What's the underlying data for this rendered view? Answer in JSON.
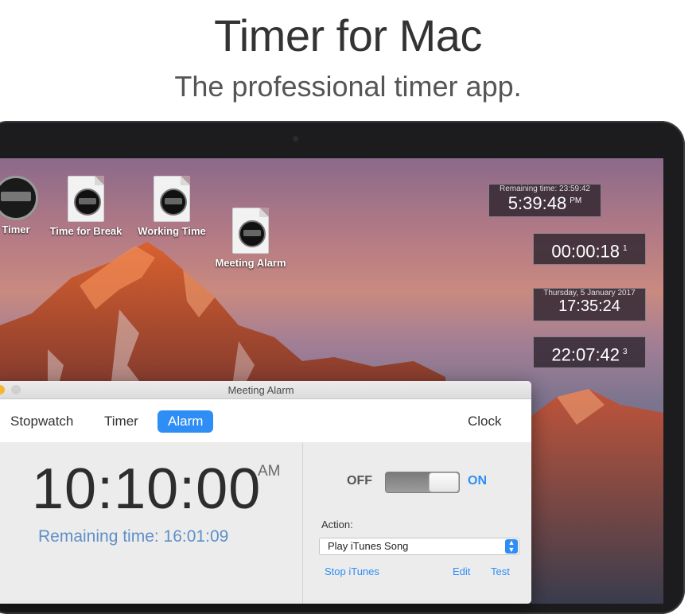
{
  "header": {
    "title": "Timer for Mac",
    "subtitle": "The professional timer app."
  },
  "desktop_icons": [
    {
      "label": "Timer",
      "icon": "clock-icon"
    },
    {
      "label": "Time for Break",
      "icon": "document-clock-icon"
    },
    {
      "label": "Working Time",
      "icon": "document-clock-icon"
    },
    {
      "label": "Meeting Alarm",
      "icon": "document-clock-icon"
    }
  ],
  "floating_timers": [
    {
      "caption": "Remaining time: 23:59:42",
      "time": "5:39:48",
      "suffix": "PM"
    },
    {
      "time": "00:00:18",
      "suffix": "1"
    },
    {
      "caption": "Thursday, 5 January 2017",
      "time": "17:35:24"
    },
    {
      "time": "22:07:42",
      "suffix": "3"
    }
  ],
  "window": {
    "title": "Meeting Alarm",
    "tabs": [
      "Stopwatch",
      "Timer",
      "Alarm",
      "Clock"
    ],
    "active_tab": "Alarm",
    "alarm_time": "10:10:00",
    "ampm": "AM",
    "remaining": "Remaining time: 16:01:09",
    "toggle": {
      "off_label": "OFF",
      "on_label": "ON",
      "state": "on"
    },
    "action_label": "Action:",
    "action_value": "Play iTunes Song",
    "links": {
      "stop": "Stop iTunes",
      "edit": "Edit",
      "test": "Test"
    }
  },
  "colors": {
    "accent": "#2f8ef6",
    "remaining_text": "#5e8fc8"
  }
}
